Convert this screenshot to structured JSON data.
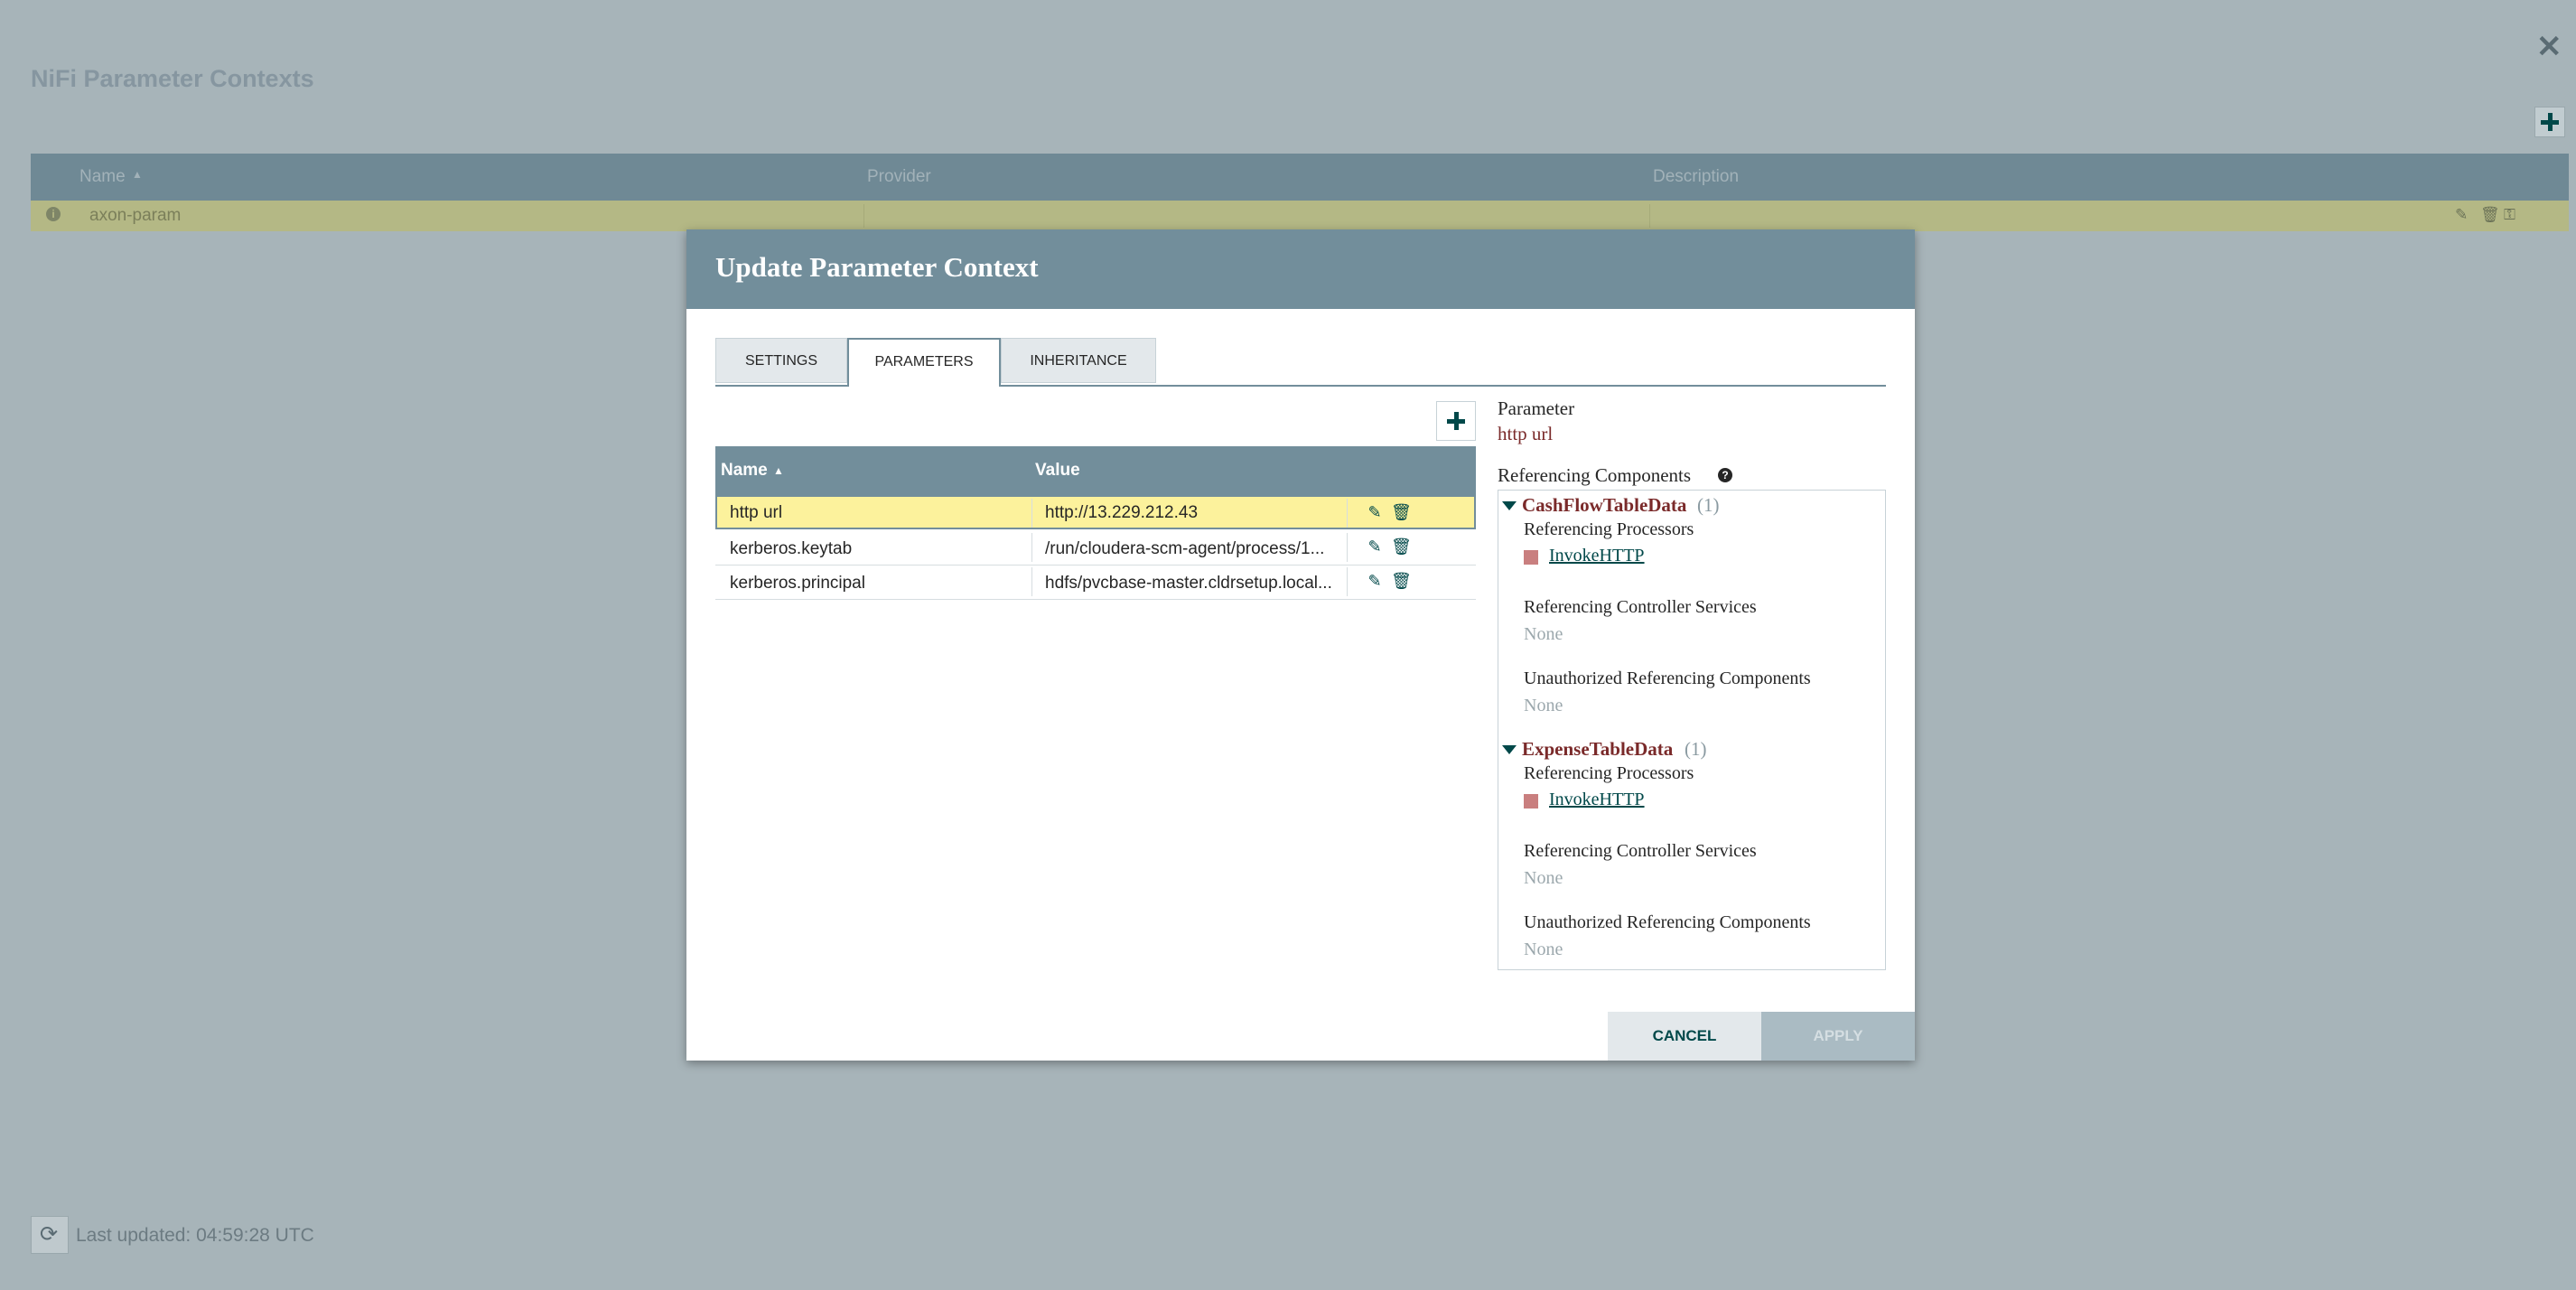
{
  "page": {
    "title": "NiFi Parameter Contexts",
    "last_updated": "Last updated: 04:59:28 UTC"
  },
  "background_table": {
    "columns": [
      "Name",
      "Provider",
      "Description"
    ],
    "rows": [
      {
        "name": "axon-param",
        "provider": "",
        "description": ""
      }
    ]
  },
  "dialog": {
    "title": "Update Parameter Context",
    "tabs": [
      "SETTINGS",
      "PARAMETERS",
      "INHERITANCE"
    ],
    "active_tab": "PARAMETERS",
    "param_table": {
      "columns": [
        "Name",
        "Value"
      ],
      "rows": [
        {
          "name": "http url",
          "value": "http://13.229.212.43"
        },
        {
          "name": "kerberos.keytab",
          "value": "/run/cloudera-scm-agent/process/1..."
        },
        {
          "name": "kerberos.principal",
          "value": "hdfs/pvcbase-master.cldrsetup.local..."
        }
      ]
    },
    "detail": {
      "parameter_label": "Parameter",
      "parameter_value": "http url",
      "ref_components_label": "Referencing Components",
      "groups": [
        {
          "name": "CashFlowTableData",
          "count": "(1)",
          "ref_processors_label": "Referencing Processors",
          "processor": "InvokeHTTP",
          "ref_cs_label": "Referencing Controller Services",
          "ref_cs_value": "None",
          "unauth_label": "Unauthorized Referencing Components",
          "unauth_value": "None"
        },
        {
          "name": "ExpenseTableData",
          "count": "(1)",
          "ref_processors_label": "Referencing Processors",
          "processor": "InvokeHTTP",
          "ref_cs_label": "Referencing Controller Services",
          "ref_cs_value": "None",
          "unauth_label": "Unauthorized Referencing Components",
          "unauth_value": "None"
        }
      ]
    },
    "buttons": {
      "cancel": "CANCEL",
      "apply": "APPLY"
    }
  },
  "icons": [
    "close-icon",
    "plus-icon",
    "info-icon",
    "sort-up-icon",
    "edit-icon",
    "delete-icon",
    "key-icon",
    "refresh-icon",
    "help-icon",
    "caret-down-icon"
  ]
}
